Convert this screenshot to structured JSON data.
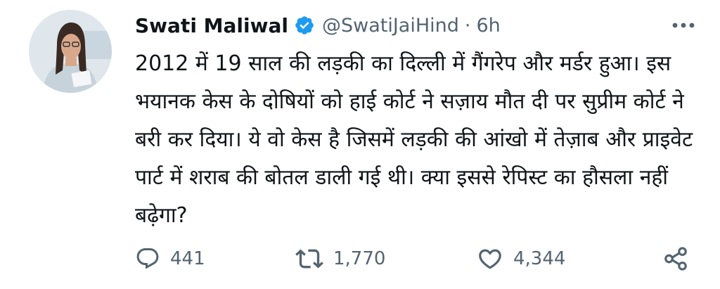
{
  "author": {
    "display_name": "Swati Maliwal",
    "handle": "@SwatiJaiHind",
    "separator": "·",
    "timestamp": "6h",
    "verified": true,
    "avatar_icon": "profile-photo"
  },
  "tweet": {
    "text": "2012 में 19 साल की लड़की का दिल्ली में गैंगरेप और मर्डर हुआ। इस भयानक केस के दोषियों को हाई कोर्ट ने सज़ाय मौत दी पर सुप्रीम कोर्ट ने बरी कर दिया। ये वो केस है जिसमें लड़की की आंखो में तेज़ाब और प्राइवेट पार्ट में शराब की बोतल डाली गई थी। क्या इससे रेपिस्ट का हौसला नहीं बढ़ेगा?"
  },
  "actions": {
    "reply": {
      "icon": "reply-icon",
      "count": "441"
    },
    "retweet": {
      "icon": "retweet-icon",
      "count": "1,770"
    },
    "like": {
      "icon": "heart-icon",
      "count": "4,344"
    },
    "share": {
      "icon": "share-icon"
    }
  },
  "colors": {
    "text_primary": "#0f1419",
    "text_secondary": "#536471",
    "verified_blue": "#1d9bf0"
  }
}
